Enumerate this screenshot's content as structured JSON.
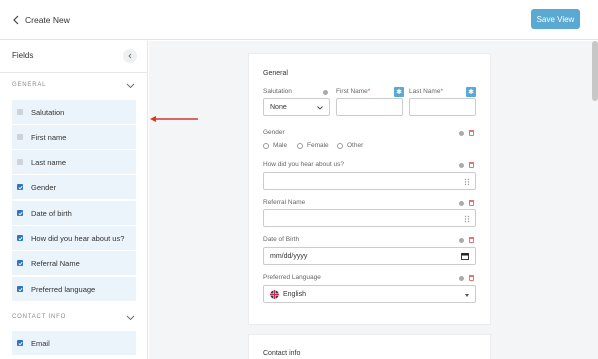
{
  "header": {
    "title": "Create New",
    "save_label": "Save View"
  },
  "sidebar": {
    "title": "Fields",
    "sections": [
      {
        "label": "GENERAL"
      },
      {
        "label": "CONTACT INFO"
      }
    ],
    "items": [
      {
        "label": "Salutation",
        "checked": "disabled"
      },
      {
        "label": "First name",
        "checked": "disabled"
      },
      {
        "label": "Last name",
        "checked": "disabled"
      },
      {
        "label": "Gender",
        "checked": true
      },
      {
        "label": "Date of birth",
        "checked": true
      },
      {
        "label": "How did you hear about us?",
        "checked": true
      },
      {
        "label": "Referral Name",
        "checked": true
      },
      {
        "label": "Preferred language",
        "checked": true
      },
      {
        "label": "Email",
        "checked": true
      }
    ]
  },
  "form": {
    "general_title": "General",
    "salutation_label": "Salutation",
    "salutation_value": "None",
    "first_name_label": "First Name",
    "last_name_label": "Last Name",
    "required_mark": "*",
    "gender_label": "Gender",
    "gender_options": [
      "Male",
      "Female",
      "Other"
    ],
    "hear_label": "How did you hear about us?",
    "referral_label": "Referral Name",
    "dob_label": "Date of Birth",
    "dob_placeholder": "mm/dd/yyyy",
    "lang_label": "Preferred Language",
    "lang_value": "English",
    "contact_title": "Contact info"
  },
  "colors": {
    "accent": "#59a9d3",
    "checkbox": "#2e73c2",
    "highlight": "#ebf4fb",
    "arrow": "#d9342b"
  }
}
